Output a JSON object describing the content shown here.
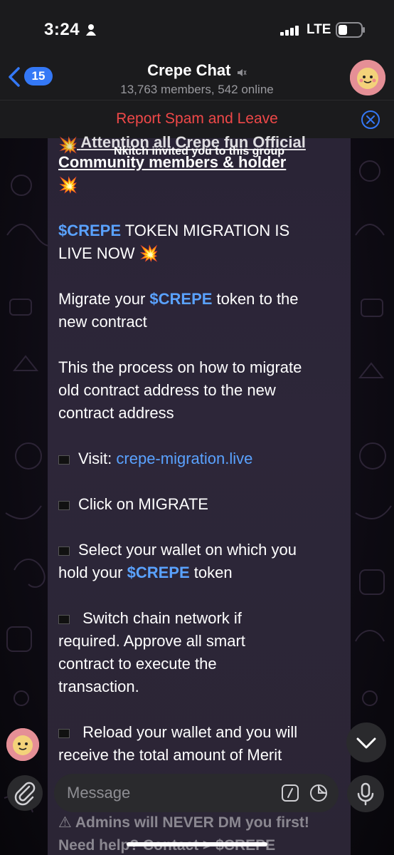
{
  "status_bar": {
    "time": "3:24",
    "network": "LTE"
  },
  "header": {
    "back_count": "15",
    "title": "Crepe Chat",
    "subtitle": "13,763 members, 542 online"
  },
  "spam_bar": {
    "label": "Report Spam and Leave"
  },
  "service_message": "Nkitch invited you to this group",
  "message": {
    "heading_line1": "Attention all Crepe fun Official",
    "heading_line2": "Community members & holder",
    "migration_tag": "$CREPE",
    "migration_rest": " TOKEN MIGRATION IS",
    "migration_line2": "LIVE NOW",
    "migrate_pre": "Migrate your ",
    "migrate_tag": "$CREPE",
    "migrate_post": " token to the",
    "migrate_line2": "new contract",
    "process_line1": "This the process on how to migrate",
    "process_line2": "old contract address to the new",
    "process_line3": "contract address",
    "visit_pre": "Visit: ",
    "visit_link": "crepe-migration.live",
    "click_line": "Click on MIGRATE",
    "select_line1": "Select your wallet on which you",
    "select_pre": "hold your ",
    "select_tag": "$CREPE",
    "select_post": " token",
    "switch_line1": "Switch chain network if",
    "switch_line2": "required. Approve all smart",
    "switch_line3": "contract to execute the",
    "switch_line4": "transaction.",
    "reload_line1": "Reload your wallet and you will",
    "reload_line2": "receive the total amount of Merit"
  },
  "footer_overlay": {
    "admins_line": "Admins will NEVER DM you first!",
    "help_line": "Need help? Contact > $CREPE"
  },
  "input": {
    "placeholder": "Message"
  },
  "colors": {
    "accent": "#3478f6",
    "link": "#5aa2ff",
    "danger": "#ef4848",
    "bubble": "#2b2535"
  }
}
